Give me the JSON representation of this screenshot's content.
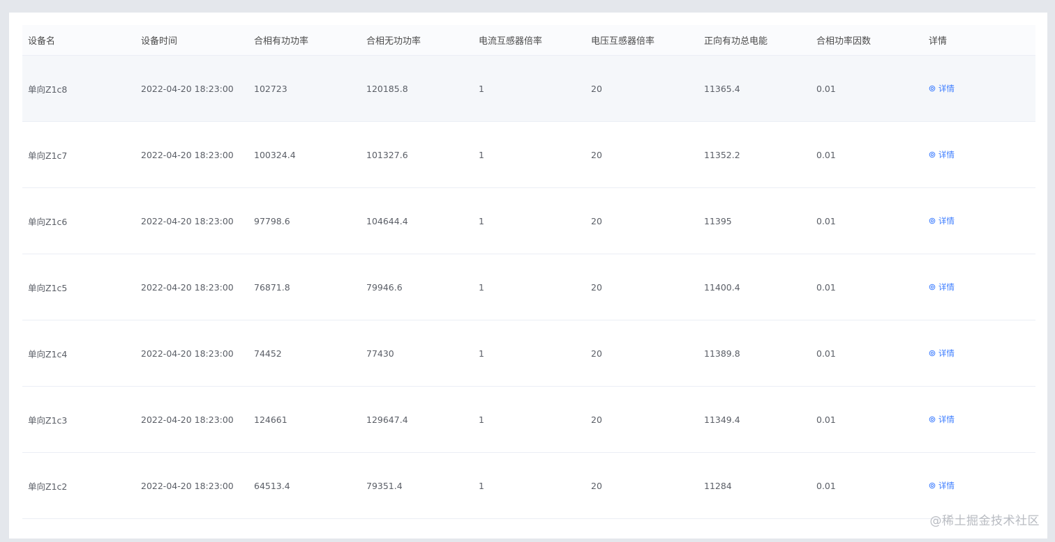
{
  "table": {
    "columns": [
      "设备名",
      "设备时间",
      "合相有功功率",
      "合相无功功率",
      "电流互感器倍率",
      "电压互感器倍率",
      "正向有功总电能",
      "合相功率因数",
      "详情"
    ],
    "detail_label": "详情",
    "detail_icon": "settings-icon",
    "link_color": "#3a7bff",
    "rows": [
      [
        "单向Z1c8",
        "2022-04-20 18:23:00",
        "102723",
        "120185.8",
        "1",
        "20",
        "11365.4",
        "0.01"
      ],
      [
        "单向Z1c7",
        "2022-04-20 18:23:00",
        "100324.4",
        "101327.6",
        "1",
        "20",
        "11352.2",
        "0.01"
      ],
      [
        "单向Z1c6",
        "2022-04-20 18:23:00",
        "97798.6",
        "104644.4",
        "1",
        "20",
        "11395",
        "0.01"
      ],
      [
        "单向Z1c5",
        "2022-04-20 18:23:00",
        "76871.8",
        "79946.6",
        "1",
        "20",
        "11400.4",
        "0.01"
      ],
      [
        "单向Z1c4",
        "2022-04-20 18:23:00",
        "74452",
        "77430",
        "1",
        "20",
        "11389.8",
        "0.01"
      ],
      [
        "单向Z1c3",
        "2022-04-20 18:23:00",
        "124661",
        "129647.4",
        "1",
        "20",
        "11349.4",
        "0.01"
      ],
      [
        "单向Z1c2",
        "2022-04-20 18:23:00",
        "64513.4",
        "79351.4",
        "1",
        "20",
        "11284",
        "0.01"
      ]
    ]
  },
  "watermark": "@稀土掘金技术社区"
}
